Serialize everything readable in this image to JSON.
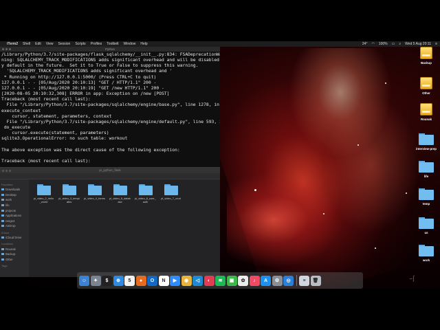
{
  "menubar": {
    "app_name": "iTerm2",
    "items": [
      "Shell",
      "Edit",
      "View",
      "Session",
      "Scripts",
      "Profiles",
      "Toolbelt",
      "Window",
      "Help"
    ],
    "clock": "Wed 5 Aug 20:11",
    "battery": "100%",
    "temperature": "24°"
  },
  "terminal": {
    "title": "Python",
    "lines": [
      "/Library/Python/3.7/site-packages/flask_sqlalchemy/__init__.py:834: FSADeprecationWar",
      "ning: SQLALCHEMY_TRACK_MODIFICATIONS adds significant overhead and will be disabled b",
      "y default in the future.  Set it to True or False to suppress this warning.",
      "  'SQLALCHEMY_TRACK_MODIFICATIONS adds significant overhead and '",
      " * Running on http://127.0.0.1:5000/ (Press CTRL+C to quit)",
      "127.0.0.1 - - [05/Aug/2020 20:10:13] \"GET / HTTP/1.1\" 200 -",
      "127.0.0.1 - - [05/Aug/2020 20:10:19] \"GET /new HTTP/1.1\" 200 -",
      "[2020-08-05 20:10:32,308] ERROR in app: Exception on /new [POST]",
      "Traceback (most recent call last):",
      "  File \"/Library/Python/3.7/site-packages/sqlalchemy/engine/base.py\", line 1278, in _",
      "execute_context",
      "    cursor, statement, parameters, context",
      "  File \"/Library/Python/3.7/site-packages/sqlalchemy/engine/default.py\", line 593, in",
      " do_execute",
      "    cursor.execute(statement, parameters)",
      "sqlite3.OperationalError: no such table: workout",
      "",
      "The above exception was the direct cause of the following exception:",
      "",
      "Traceback (most recent call last):"
    ]
  },
  "finder": {
    "title": "pi_python_flask",
    "sidebar_sections": [
      {
        "label": "Favorites",
        "items": [
          {
            "label": "Downloads",
            "count": ""
          },
          {
            "label": "Desktop",
            "count": ""
          },
          {
            "label": "work",
            "count": ""
          },
          {
            "label": "lifo",
            "count": ""
          },
          {
            "label": "projects",
            "count": ""
          },
          {
            "label": "Applications",
            "count": ""
          },
          {
            "label": "range4",
            "count": ""
          },
          {
            "label": "AirDrop",
            "count": ""
          }
        ]
      },
      {
        "label": "iCloud",
        "items": [
          {
            "label": "iCloud Drive",
            "count": ""
          }
        ]
      },
      {
        "label": "Locations",
        "items": [
          {
            "label": "Rounak",
            "count": ""
          },
          {
            "label": "Backup",
            "count": ""
          },
          {
            "label": "Other",
            "count": ""
          }
        ]
      },
      {
        "label": "Tags",
        "items": []
      }
    ],
    "files": [
      "pi_video_2_hello_world",
      "pi_video_3_templates",
      "pi_video_4_forms",
      "pi_video_5_database",
      "pi_video_6_user_auth",
      "pi_video_7_crud"
    ]
  },
  "desktop": {
    "icons": [
      {
        "label": "Backup",
        "kind": "drive"
      },
      {
        "label": "Other",
        "kind": "drive"
      },
      {
        "label": "Rounak",
        "kind": "drive"
      },
      {
        "label": "interview-prep",
        "kind": "folder"
      },
      {
        "label": "life",
        "kind": "folder"
      },
      {
        "label": "temp",
        "kind": "folder"
      },
      {
        "label": "us",
        "kind": "folder"
      },
      {
        "label": "work",
        "kind": "folder"
      }
    ]
  },
  "dock": {
    "apps": [
      {
        "name": "finder-icon",
        "color": "#3b82d6",
        "glyph": "☺"
      },
      {
        "name": "launchpad-icon",
        "color": "#7a8591",
        "glyph": "✦"
      },
      {
        "name": "terminal-icon",
        "color": "#222",
        "glyph": "$"
      },
      {
        "name": "safari-icon",
        "color": "#2d8ae0",
        "glyph": "⊕"
      },
      {
        "name": "calendar-icon",
        "color": "#f2f2f2",
        "glyph": "5"
      },
      {
        "name": "firefox-icon",
        "color": "#e66b1f",
        "glyph": "●"
      },
      {
        "name": "outlook-icon",
        "color": "#1368c4",
        "glyph": "O"
      },
      {
        "name": "notion-icon",
        "color": "#fff",
        "glyph": "N"
      },
      {
        "name": "zoom-icon",
        "color": "#2d8cff",
        "glyph": "▶"
      },
      {
        "name": "chrome-icon",
        "color": "#e8b53a",
        "glyph": "◉"
      },
      {
        "name": "vscode-icon",
        "color": "#1f8ad2",
        "glyph": "◁"
      },
      {
        "name": "pocket-icon",
        "color": "#e23d53",
        "glyph": "◐"
      },
      {
        "name": "spotify-icon",
        "color": "#1db954",
        "glyph": "≋"
      },
      {
        "name": "facetime-icon",
        "color": "#3cb94a",
        "glyph": "▣"
      },
      {
        "name": "photos-icon",
        "color": "#ececec",
        "glyph": "✿"
      },
      {
        "name": "music-icon",
        "color": "#f24a64",
        "glyph": "♪"
      },
      {
        "name": "appstore-icon",
        "color": "#1e90f0",
        "glyph": "A"
      },
      {
        "name": "system-prefs-icon",
        "color": "#8a8f96",
        "glyph": "⚙"
      },
      {
        "name": "screen-recorder-icon",
        "color": "#2a7fd6",
        "glyph": "◎"
      },
      {
        "name": "downloads-stack-icon",
        "color": "#cfd6df",
        "glyph": "≡"
      },
      {
        "name": "trash-icon",
        "color": "#b9bec4",
        "glyph": "🗑"
      }
    ]
  }
}
